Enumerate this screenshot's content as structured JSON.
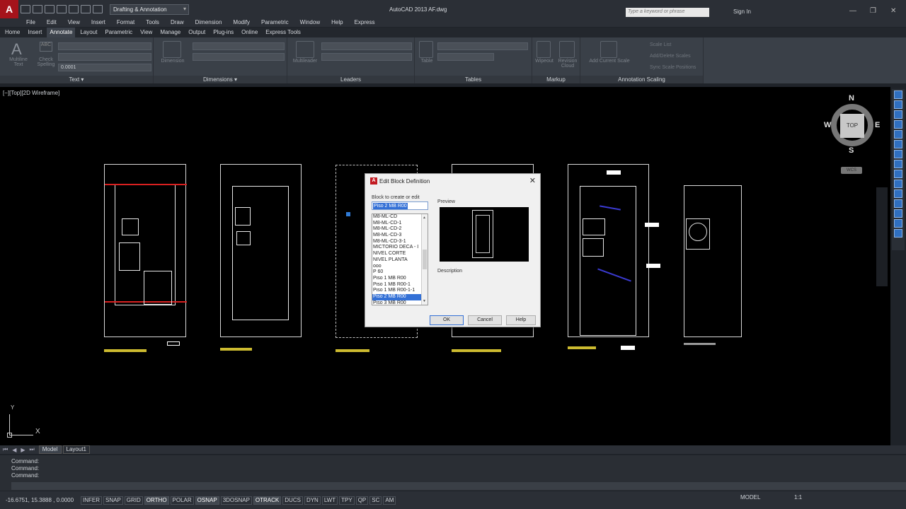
{
  "titlebar": {
    "workspace": "Drafting & Annotation",
    "title": "AutoCAD 2013   AF.dwg",
    "search_placeholder": "Type a keyword or phrase",
    "sign_in": "Sign In"
  },
  "menu": [
    "File",
    "Edit",
    "View",
    "Insert",
    "Format",
    "Tools",
    "Draw",
    "Dimension",
    "Modify",
    "Parametric",
    "Window",
    "Help",
    "Express"
  ],
  "ribbon_tabs": [
    "Home",
    "Insert",
    "Annotate",
    "Layout",
    "Parametric",
    "View",
    "Manage",
    "Output",
    "Plug-ins",
    "Online",
    "Express Tools"
  ],
  "ribbon_active_tab": "Annotate",
  "ribbon": {
    "text_panel": {
      "title": "Text ▾",
      "multiline": "Multiline\nText",
      "check": "Check\nSpelling",
      "height": "0.0001"
    },
    "dimensions_panel": {
      "title": "Dimensions ▾",
      "dimension": "Dimension"
    },
    "leaders_panel": {
      "title": "Leaders",
      "multileader": "Multileader"
    },
    "tables_panel": {
      "title": "Tables",
      "table": "Table"
    },
    "markup_panel": {
      "title": "Markup",
      "wipeout": "Wipeout",
      "revcloud": "Revision\nCloud"
    },
    "scaling_panel": {
      "title": "Annotation Scaling",
      "add_scale": "Add Current Scale",
      "scale_list": "Scale List",
      "add_delete": "Add/Delete Scales",
      "sync": "Sync Scale Positions"
    }
  },
  "viewport_label": "[−][Top][2D Wireframe]",
  "viewcube": {
    "n": "N",
    "s": "S",
    "e": "E",
    "w": "W",
    "face": "TOP",
    "wcs": "WCS"
  },
  "ucs": {
    "x": "X",
    "y": "Y"
  },
  "layout_tabs": [
    "Model",
    "Layout1"
  ],
  "command_lines": [
    "Command:",
    "Command:",
    "Command:"
  ],
  "status": {
    "coords": "-16.6751, 15.3888 , 0.0000",
    "toggles": [
      {
        "label": "INFER",
        "on": false
      },
      {
        "label": "SNAP",
        "on": false
      },
      {
        "label": "GRID",
        "on": false
      },
      {
        "label": "ORTHO",
        "on": true
      },
      {
        "label": "POLAR",
        "on": false
      },
      {
        "label": "OSNAP",
        "on": true
      },
      {
        "label": "3DOSNAP",
        "on": false
      },
      {
        "label": "OTRACK",
        "on": true
      },
      {
        "label": "DUCS",
        "on": false
      },
      {
        "label": "DYN",
        "on": false
      },
      {
        "label": "LWT",
        "on": false
      },
      {
        "label": "TPY",
        "on": false
      },
      {
        "label": "QP",
        "on": false
      },
      {
        "label": "SC",
        "on": false
      },
      {
        "label": "AM",
        "on": false
      }
    ],
    "model": "MODEL",
    "scale": "1:1"
  },
  "dialog": {
    "title": "Edit Block Definition",
    "block_label": "Block to create or edit",
    "block_value": "Piso 2 MB R00",
    "list_items": [
      "M8-ML-CD",
      "M8-ML-CD-1",
      "M8-ML-CD-2",
      "M8-ML-CD-3",
      "M8-ML-CD-3-1",
      "MICTÓRIO DECA - I",
      "NÍVEL CORTE",
      "NÍVEL PLANTA",
      "ooo",
      "P 60",
      "Piso 1 MB R00",
      "Piso 1 MB R00-1",
      "Piso 1 MB R00-1-1",
      "Piso 2 MB R00",
      "Piso 3 MB R00"
    ],
    "selected_item": "Piso 2 MB R00",
    "preview_label": "Preview",
    "description_label": "Description",
    "ok": "OK",
    "cancel": "Cancel",
    "help": "Help"
  },
  "colors": {
    "accent": "#3370d6",
    "brand": "#a5131b",
    "sheet_label": "#e5d13a"
  }
}
